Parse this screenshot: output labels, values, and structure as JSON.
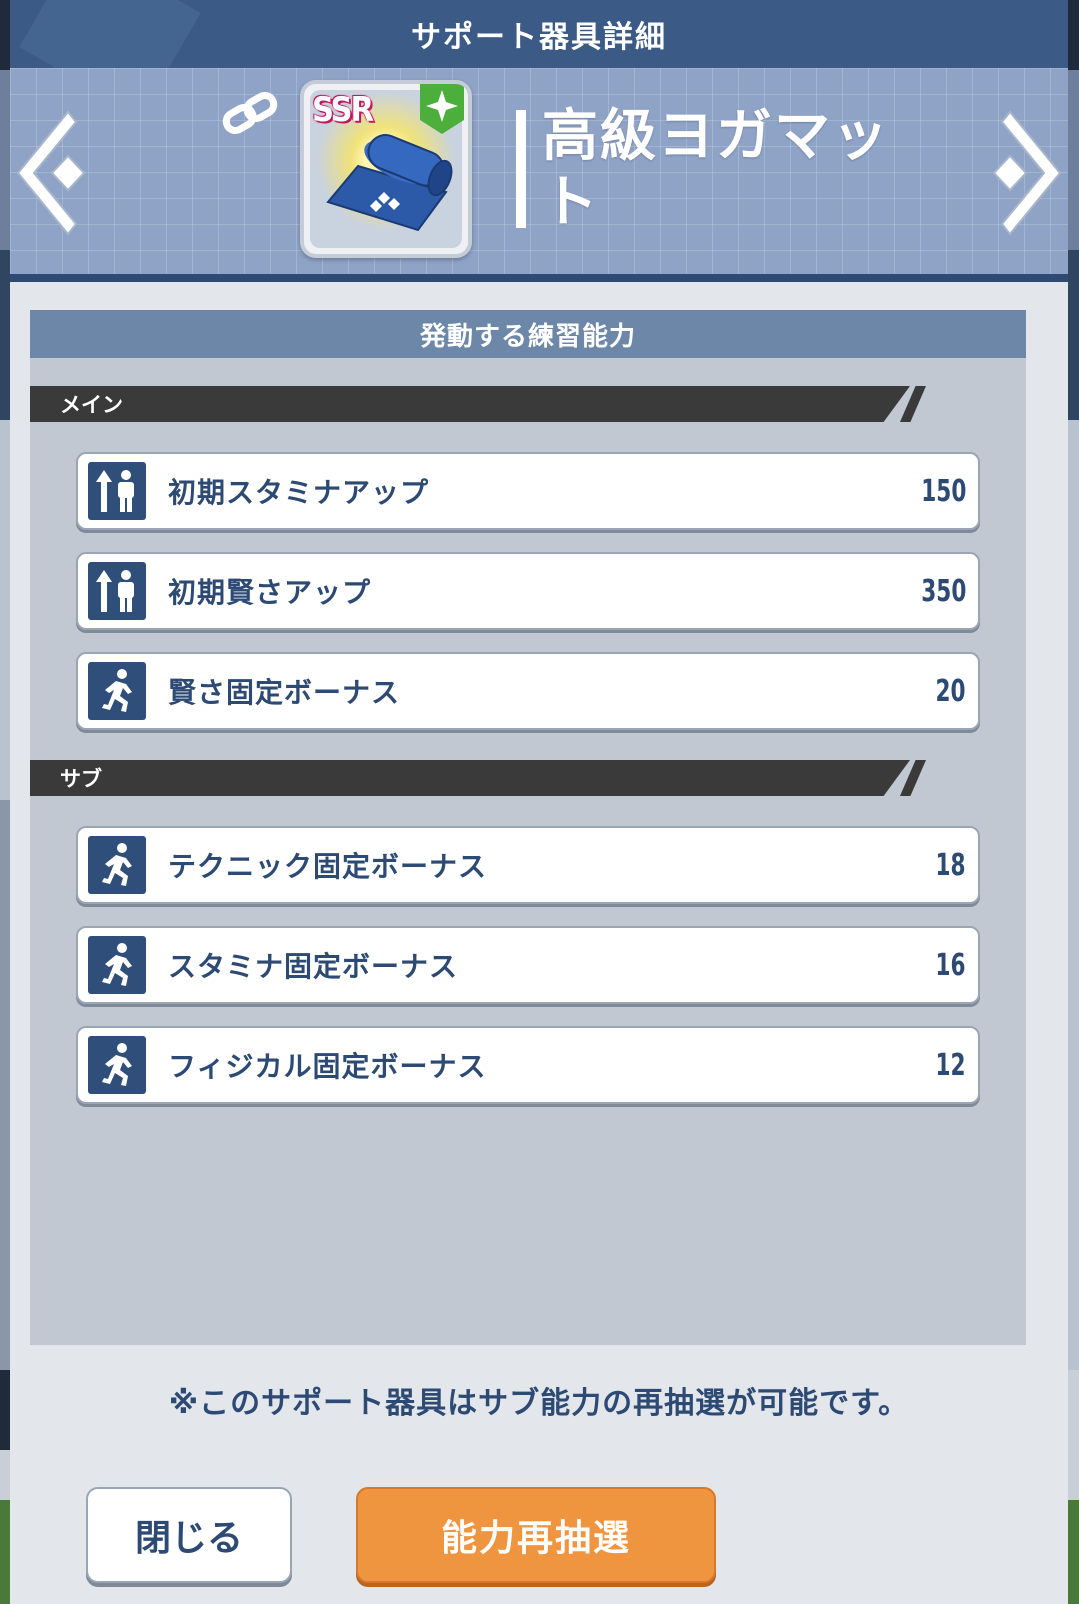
{
  "title": "サポート器具詳細",
  "item": {
    "name": "高級ヨガマット",
    "rarity": "SSR",
    "badge": "plus-badge"
  },
  "panel": {
    "header": "発動する練習能力",
    "main_label": "メイン",
    "sub_label": "サブ",
    "main_abilities": [
      {
        "icon": "stamina-up-icon",
        "name": "初期スタミナアップ",
        "value": "150"
      },
      {
        "icon": "stamina-up-icon",
        "name": "初期賢さアップ",
        "value": "350"
      },
      {
        "icon": "running-icon",
        "name": "賢さ固定ボーナス",
        "value": "20"
      }
    ],
    "sub_abilities": [
      {
        "icon": "running-icon",
        "name": "テクニック固定ボーナス",
        "value": "18"
      },
      {
        "icon": "running-icon",
        "name": "スタミナ固定ボーナス",
        "value": "16"
      },
      {
        "icon": "running-icon",
        "name": "フィジカル固定ボーナス",
        "value": "12"
      }
    ]
  },
  "note": "※このサポート器具はサブ能力の再抽選が可能です。",
  "buttons": {
    "close": "閉じる",
    "reroll": "能力再抽選"
  },
  "colors": {
    "title_bar": "#3b5a86",
    "text_blue": "#2c4a73",
    "reroll_orange": "#f0953f",
    "plus_green": "#4caf3c"
  }
}
